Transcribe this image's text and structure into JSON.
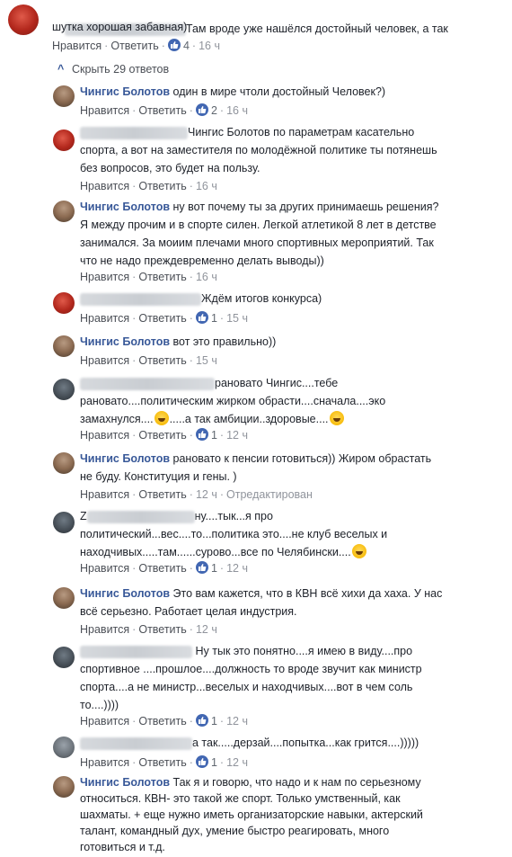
{
  "actions": {
    "like": "Нравится",
    "reply": "Ответить",
    "separator": "·"
  },
  "hide_replies": {
    "label": "Скрыть 29 ответов"
  },
  "top_comment": {
    "text_line1": "Там вроде уже нашёлся достойный человек, а так",
    "text_line2": "шутка хорошая забавная)",
    "likes": "4",
    "time": "16 ч"
  },
  "replies": [
    {
      "author": "Чингис Болотов",
      "text": "один в мире чтоли достойный Человек?)",
      "likes": "2",
      "time": "16 ч"
    },
    {
      "text_line1": "Чингис Болотов по параметрам касательно",
      "text_line2": "спорта, а вот на заместителя по молодёжной политике ты потянешь",
      "text_line3": "без вопросов, это будет на пользу.",
      "time": "16 ч"
    },
    {
      "author": "Чингис Болотов",
      "text_line1": "ну вот почему ты за других принимаешь решения?",
      "text_line2": "Я между прочим и в спорте силен. Легкой атлетикой 8 лет в детстве",
      "text_line3": "занимался. За моиим плечами много спортивных мероприятий. Так",
      "text_line4": "что не надо преждевременно делать выводы))",
      "time": "16 ч"
    },
    {
      "text": "Ждём итогов конкурса)",
      "likes": "1",
      "time": "15 ч"
    },
    {
      "author": "Чингис Болотов",
      "text": "вот это правильно))",
      "time": "15 ч"
    },
    {
      "text_line1": "рановато Чингис....тебе",
      "text_line2": "рановато....политическим жирком обрасти....сначала....эко",
      "text_line3a": "замахнулся....",
      "text_line3b": ".....а так амбиции..здоровые....",
      "likes": "1",
      "time": "12 ч"
    },
    {
      "author": "Чингис Болотов",
      "text_line1": "рановато к пенсии готовиться)) Жиром обрастать",
      "text_line2": "не буду. Конституция и гены. )",
      "time": "12 ч",
      "edited": "Отредактирован"
    },
    {
      "name_visible": "Z",
      "text_line1": "ну....тык...я про",
      "text_line2": "политический...вес....то...политика это....не клуб веселых и",
      "text_line3": "находчивых.....там......сурово...все по Челябински....",
      "likes": "1",
      "time": "12 ч"
    },
    {
      "author": "Чингис Болотов",
      "text_line1": "Это вам кажется, что в КВН всё хихи да хаха. У нас",
      "text_line2": "всё серьезно. Работает целая индустрия.",
      "time": "12 ч"
    },
    {
      "text_line1": "Ну тык это понятно....я имею в виду....про",
      "text_line2": "спортивное ....прошлое....должность то вроде звучит как министр",
      "text_line3": "спорта....а не министр...веселых и находчивых....вот в чем соль",
      "text_line4": "то....))))",
      "likes": "1",
      "time": "12 ч"
    },
    {
      "text": "а так.....дерзай....попытка...как грится....)))))",
      "likes": "1",
      "time": "12 ч"
    },
    {
      "author": "Чингис Болотов",
      "text_line1": "Так я и говорю, что надо и к нам по серьезному",
      "text_line2": "относиться. КВН- это такой же спорт. Только умственный, как",
      "text_line3": "шахматы. + еще нужно иметь организаторские навыки, актерский",
      "text_line4": "талант, командный дух, умение быстро реагировать, много",
      "text_line5": "готовиться и т.д."
    }
  ]
}
